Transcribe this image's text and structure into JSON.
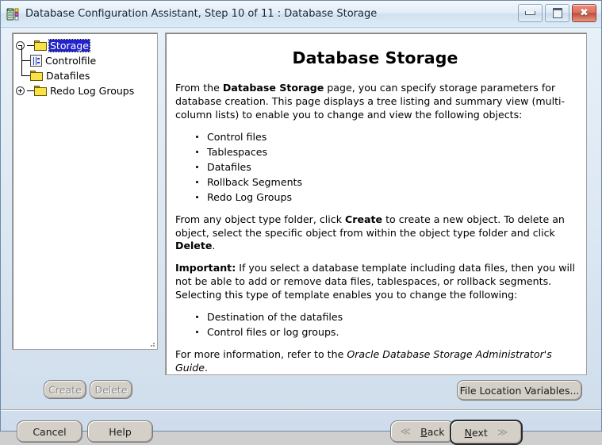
{
  "window": {
    "title": "Database Configuration Assistant, Step 10 of 11 : Database Storage",
    "icon": "database-app-icon",
    "controls": {
      "minimize": "Minimize",
      "maximize": "Maximize",
      "close": "Close"
    }
  },
  "tree": {
    "nodes": [
      {
        "label": "Storage",
        "icon": "folder-icon",
        "toggle": "collapse-minus",
        "selected": true
      },
      {
        "label": "Controlfile",
        "icon": "controlfile-document-icon",
        "toggle": "none",
        "selected": false
      },
      {
        "label": "Datafiles",
        "icon": "folder-icon",
        "toggle": "none",
        "selected": false
      },
      {
        "label": "Redo Log Groups",
        "icon": "folder-icon",
        "toggle": "expand-plus",
        "selected": false
      }
    ]
  },
  "help": {
    "title": "Database Storage",
    "paragraph1_pre": "From the ",
    "paragraph1_bold": "Database Storage",
    "paragraph1_post": " page, you can specify storage parameters for database creation. This page displays a tree listing and summary view (multi-column lists) to enable you to change and view the following objects:",
    "list1": [
      "Control files",
      "Tablespaces",
      "Datafiles",
      "Rollback Segments",
      "Redo Log Groups"
    ],
    "paragraph2_pre": "From any object type folder, click ",
    "paragraph2_bold1": "Create",
    "paragraph2_mid": " to create a new object. To delete an object, select the specific object from within the object type folder and click ",
    "paragraph2_bold2": "Delete",
    "paragraph2_post": ".",
    "paragraph3_bold": "Important:",
    "paragraph3_post": " If you select a database template including data files, then you will not be able to add or remove data files, tablespaces, or rollback segments. Selecting this type of template enables you to change the following:",
    "list2": [
      "Destination of the datafiles",
      "Control files or log groups."
    ],
    "paragraph4_pre": "For more information, refer to the ",
    "paragraph4_italic": "Oracle Database Storage Administrator's Guide",
    "paragraph4_post": "."
  },
  "buttons": {
    "create": "Create",
    "delete": "Delete",
    "file_location_variables": "File Location Variables...",
    "cancel": "Cancel",
    "help": "Help",
    "back": "Back",
    "back_mnemonic": "B",
    "next": "Next",
    "next_mnemonic": "N",
    "back_chevron": "≪",
    "next_chevron": "≫"
  },
  "colors": {
    "selection": "#2222cc",
    "folder": "#f7e24a",
    "close_button": "#c04a35",
    "panel_background": "#ffffff",
    "dialog_background": "#cfcfcf"
  }
}
